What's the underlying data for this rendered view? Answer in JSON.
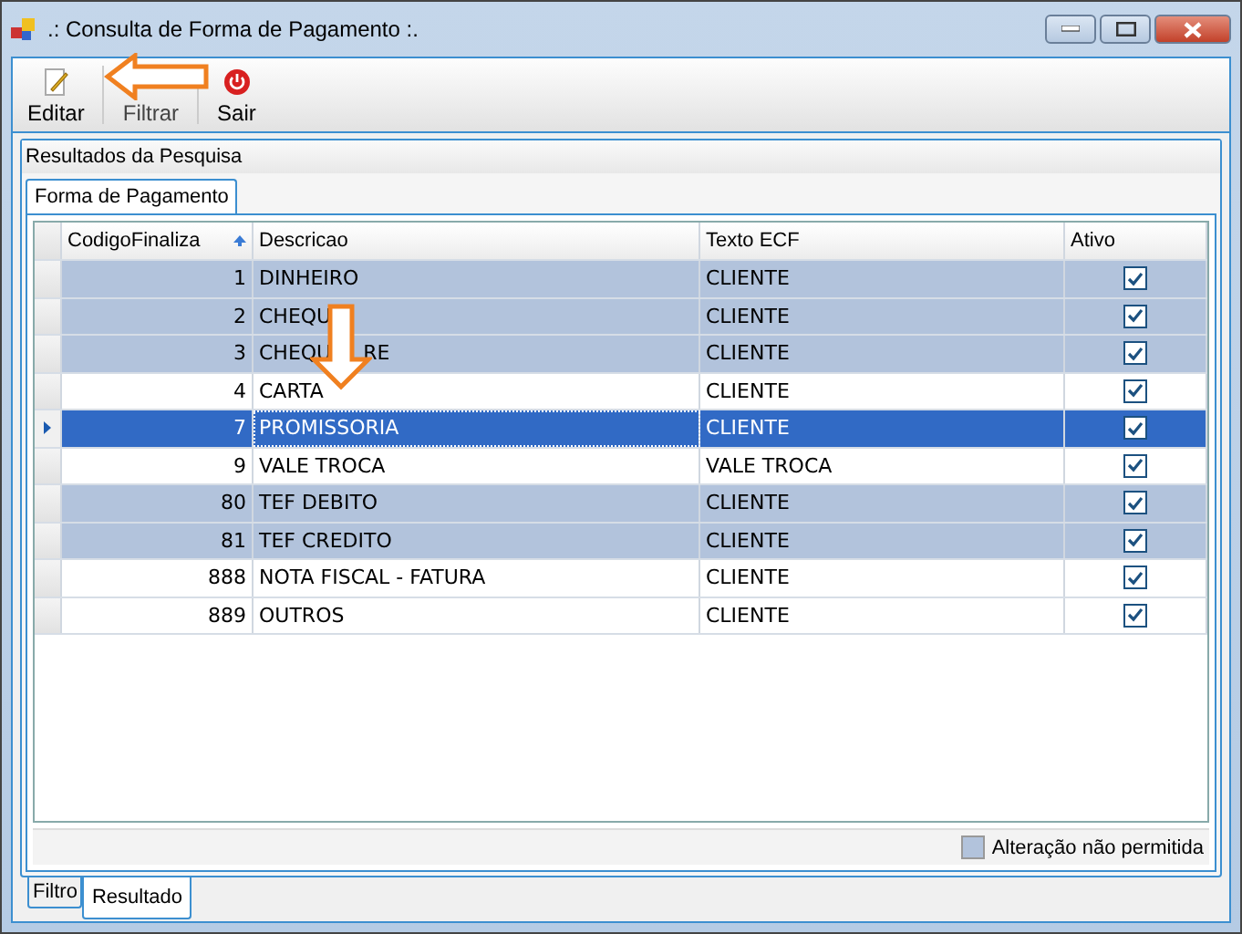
{
  "window": {
    "title": ".: Consulta de Forma de Pagamento :."
  },
  "toolbar": [
    {
      "label": "Editar",
      "kind": "edit",
      "disabled": false
    },
    {
      "label": "Filtrar",
      "kind": "filter",
      "disabled": true
    },
    {
      "label": "Sair",
      "kind": "exit",
      "disabled": false
    }
  ],
  "group": {
    "title": "Resultados da Pesquisa"
  },
  "inner_tabs": [
    {
      "label": "Forma de Pagamento",
      "selected": true
    }
  ],
  "table": {
    "columns": [
      "CodigoFinaliza",
      "Descricao",
      "Texto ECF",
      "Ativo"
    ],
    "rows": [
      {
        "code": "1",
        "description": "DINHEIRO",
        "ecf": "CLIENTE",
        "active": true,
        "highlighted": true,
        "selected": false
      },
      {
        "code": "2",
        "description": "CHEQU",
        "ecf": "CLIENTE",
        "active": true,
        "highlighted": true,
        "selected": false
      },
      {
        "code": "3",
        "description": "CHEQU     RE",
        "ecf": "CLIENTE",
        "active": true,
        "highlighted": true,
        "selected": false
      },
      {
        "code": "4",
        "description": "CARTA",
        "ecf": "CLIENTE",
        "active": true,
        "highlighted": false,
        "selected": false
      },
      {
        "code": "7",
        "description": "PROMISSORIA",
        "ecf": "CLIENTE",
        "active": true,
        "highlighted": false,
        "selected": true
      },
      {
        "code": "9",
        "description": "VALE TROCA",
        "ecf": "VALE TROCA",
        "active": true,
        "highlighted": false,
        "selected": false
      },
      {
        "code": "80",
        "description": "TEF DEBITO",
        "ecf": "CLIENTE",
        "active": true,
        "highlighted": true,
        "selected": false
      },
      {
        "code": "81",
        "description": "TEF CREDITO",
        "ecf": "CLIENTE",
        "active": true,
        "highlighted": true,
        "selected": false
      },
      {
        "code": "888",
        "description": "NOTA FISCAL - FATURA",
        "ecf": "CLIENTE",
        "active": true,
        "highlighted": false,
        "selected": false
      },
      {
        "code": "889",
        "description": "OUTROS",
        "ecf": "CLIENTE",
        "active": true,
        "highlighted": false,
        "selected": false
      }
    ]
  },
  "legend": {
    "label": "Alteração não permitida"
  },
  "bottom_tabs": [
    {
      "label": "Filtro",
      "selected": false
    },
    {
      "label": "Resultado",
      "selected": true
    }
  ]
}
